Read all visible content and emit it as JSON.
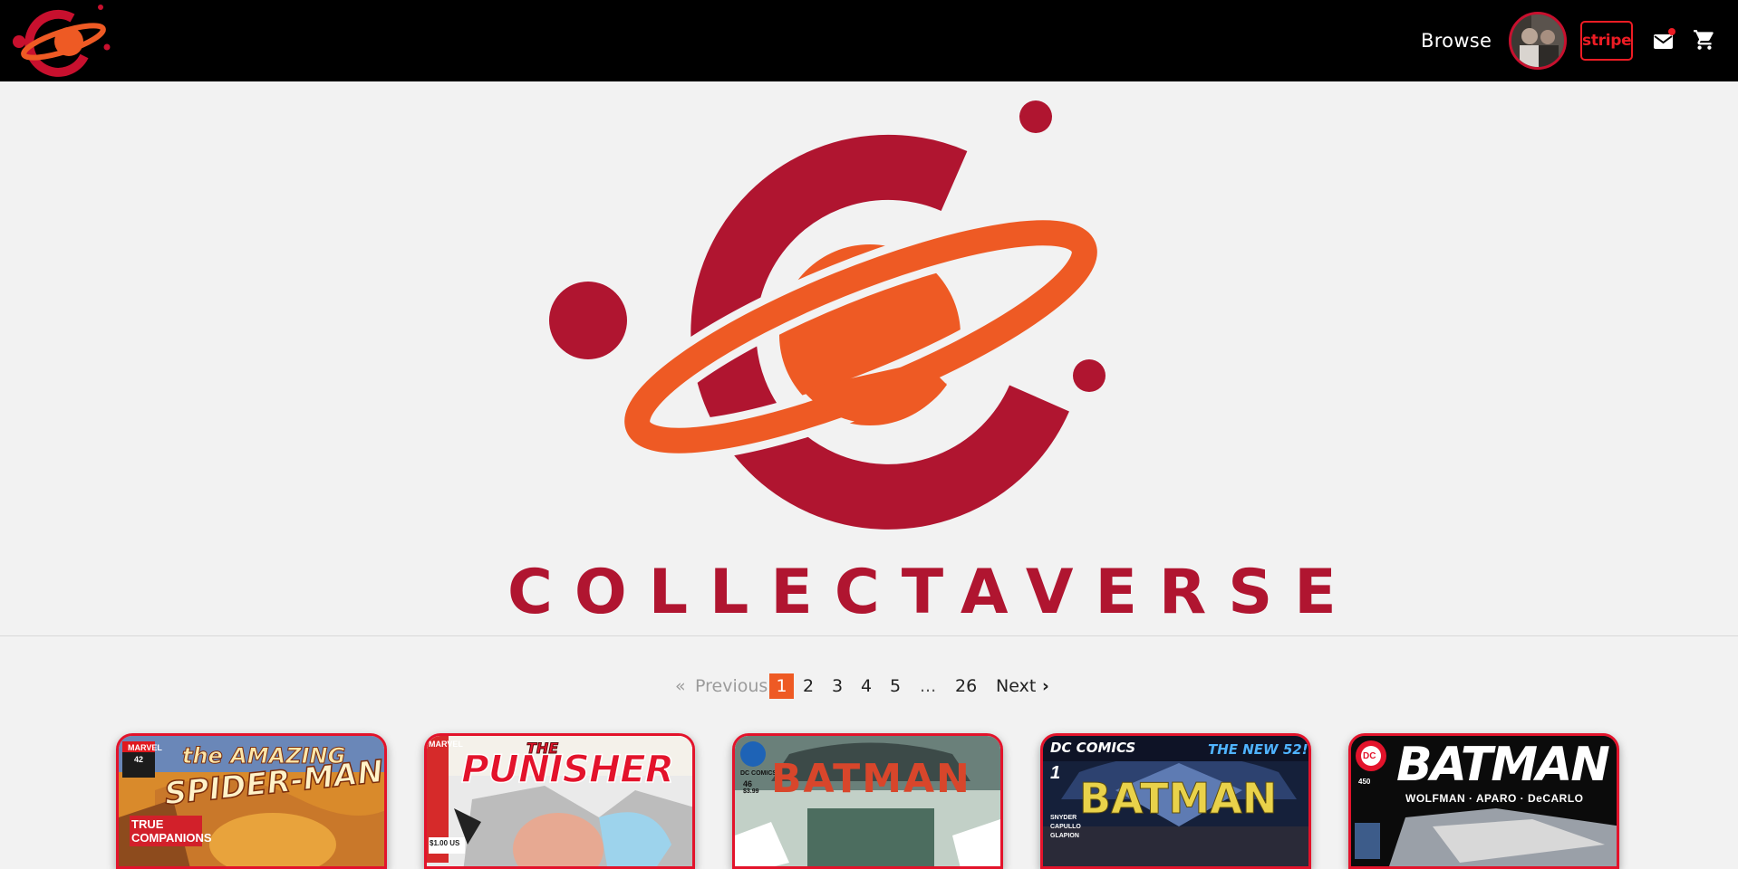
{
  "nav": {
    "browse_label": "Browse",
    "stripe_label": "stripe",
    "icons": [
      "logo-icon",
      "mail-icon",
      "cart-icon"
    ]
  },
  "hero": {
    "brand_name": "COLLECTAVERSE"
  },
  "pagination": {
    "previous_label": "Previous",
    "previous_arrow": "«",
    "pages": [
      "1",
      "2",
      "3",
      "4",
      "5"
    ],
    "active_page": "1",
    "ellipsis": "...",
    "last_page": "26",
    "next_label": "Next",
    "next_arrow": "›"
  },
  "comics": [
    {
      "title_line1": "the AMAZING",
      "title_line2": "SPIDER-MAN",
      "publisher": "MARVEL",
      "issue": "42",
      "tagline": "TRUE COMPANIONS"
    },
    {
      "title_line1": "THE",
      "title_line2": "PUNISHER",
      "publisher": "MARVEL",
      "issue": "",
      "tagline": "$1.00 US"
    },
    {
      "title_line1": "",
      "title_line2": "BATMAN",
      "publisher": "DC COMICS",
      "issue": "46",
      "tagline": "$3.99"
    },
    {
      "title_line1": "DC COMICS",
      "title_line2": "BATMAN",
      "publisher": "THE NEW 52!",
      "issue": "1",
      "tagline": "SNYDER CAPULLO GLAPION"
    },
    {
      "title_line1": "",
      "title_line2": "BATMAN",
      "publisher": "DC",
      "issue": "450",
      "tagline": "WOLFMAN · APARO · DeCARLO"
    }
  ],
  "colors": {
    "brand_red": "#b01530",
    "brand_orange": "#ee5a24",
    "accent_red": "#e3132b"
  }
}
